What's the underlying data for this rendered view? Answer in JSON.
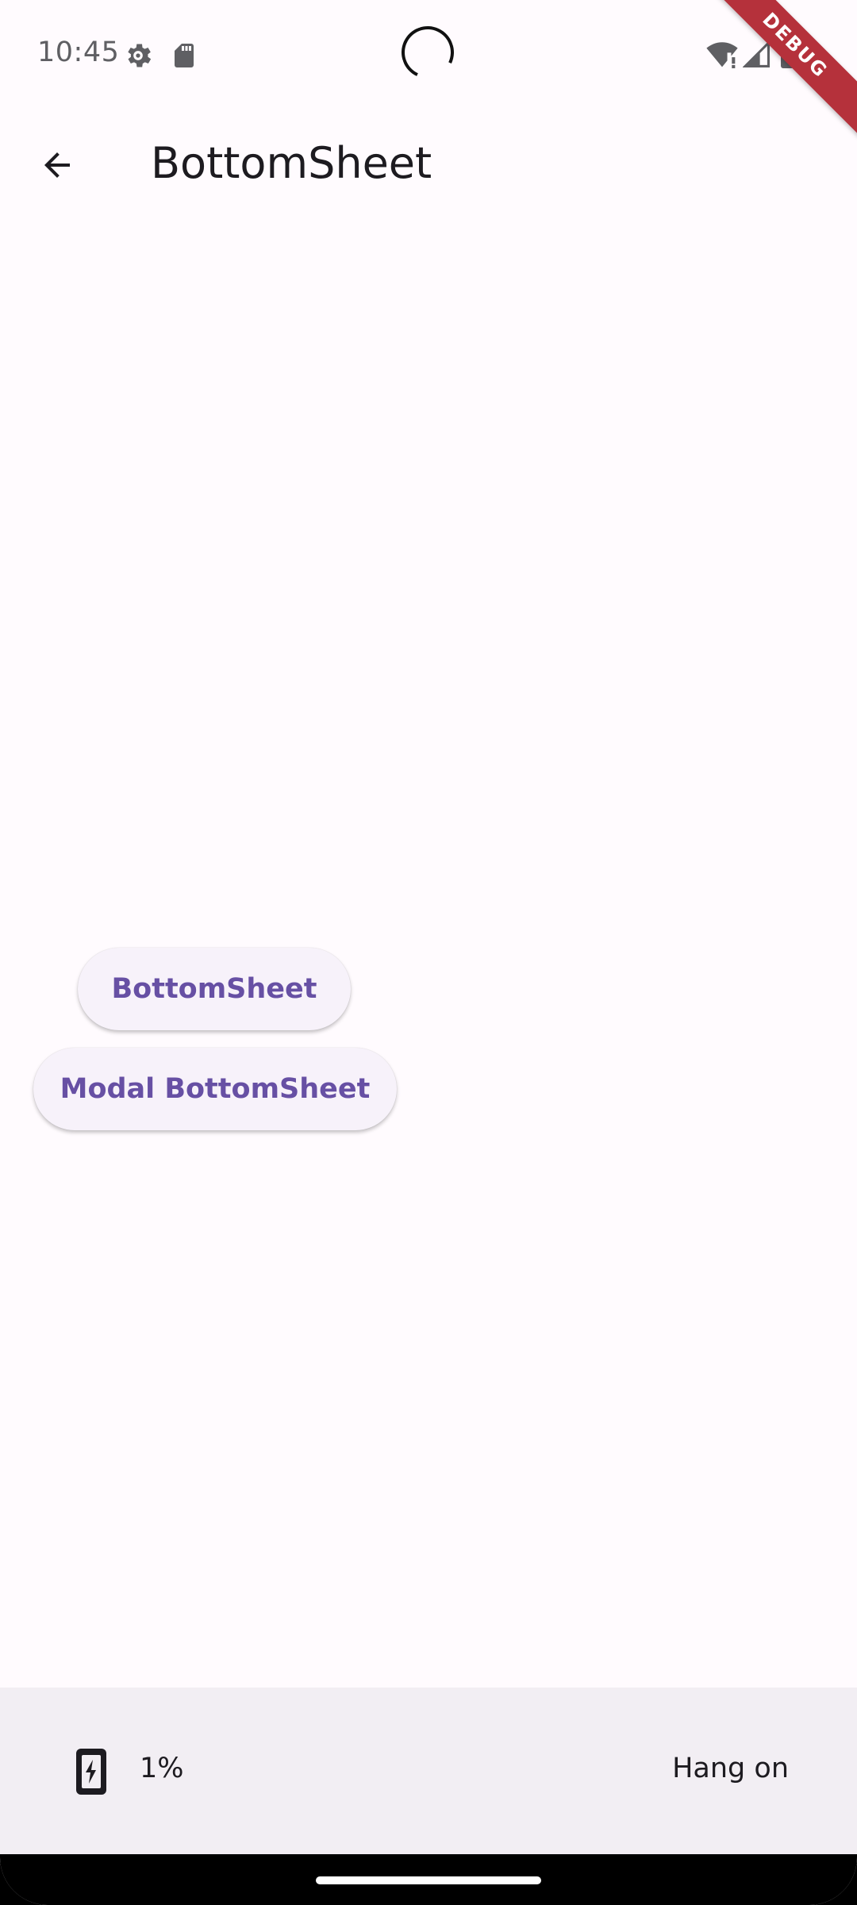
{
  "status_bar": {
    "time": "10:45",
    "icons": [
      "settings-gear-icon",
      "sd-card-icon",
      "wifi-alert-icon",
      "signal-icon",
      "battery-icon"
    ]
  },
  "debug_banner": "DEBUG",
  "app_bar": {
    "title": "BottomSheet",
    "back_icon": "arrow-back-icon"
  },
  "main": {
    "buttons": [
      {
        "label": "BottomSheet"
      },
      {
        "label": "Modal BottomSheet"
      }
    ]
  },
  "bottom_panel": {
    "battery_percent": "1%",
    "message": "Hang on",
    "icon": "battery-charging-icon"
  },
  "colors": {
    "background": "#fffbfe",
    "accent": "#6750a4",
    "button_bg": "#f7f2fa",
    "panel_bg": "#f2eef3",
    "debug_ribbon": "#b5313b"
  }
}
